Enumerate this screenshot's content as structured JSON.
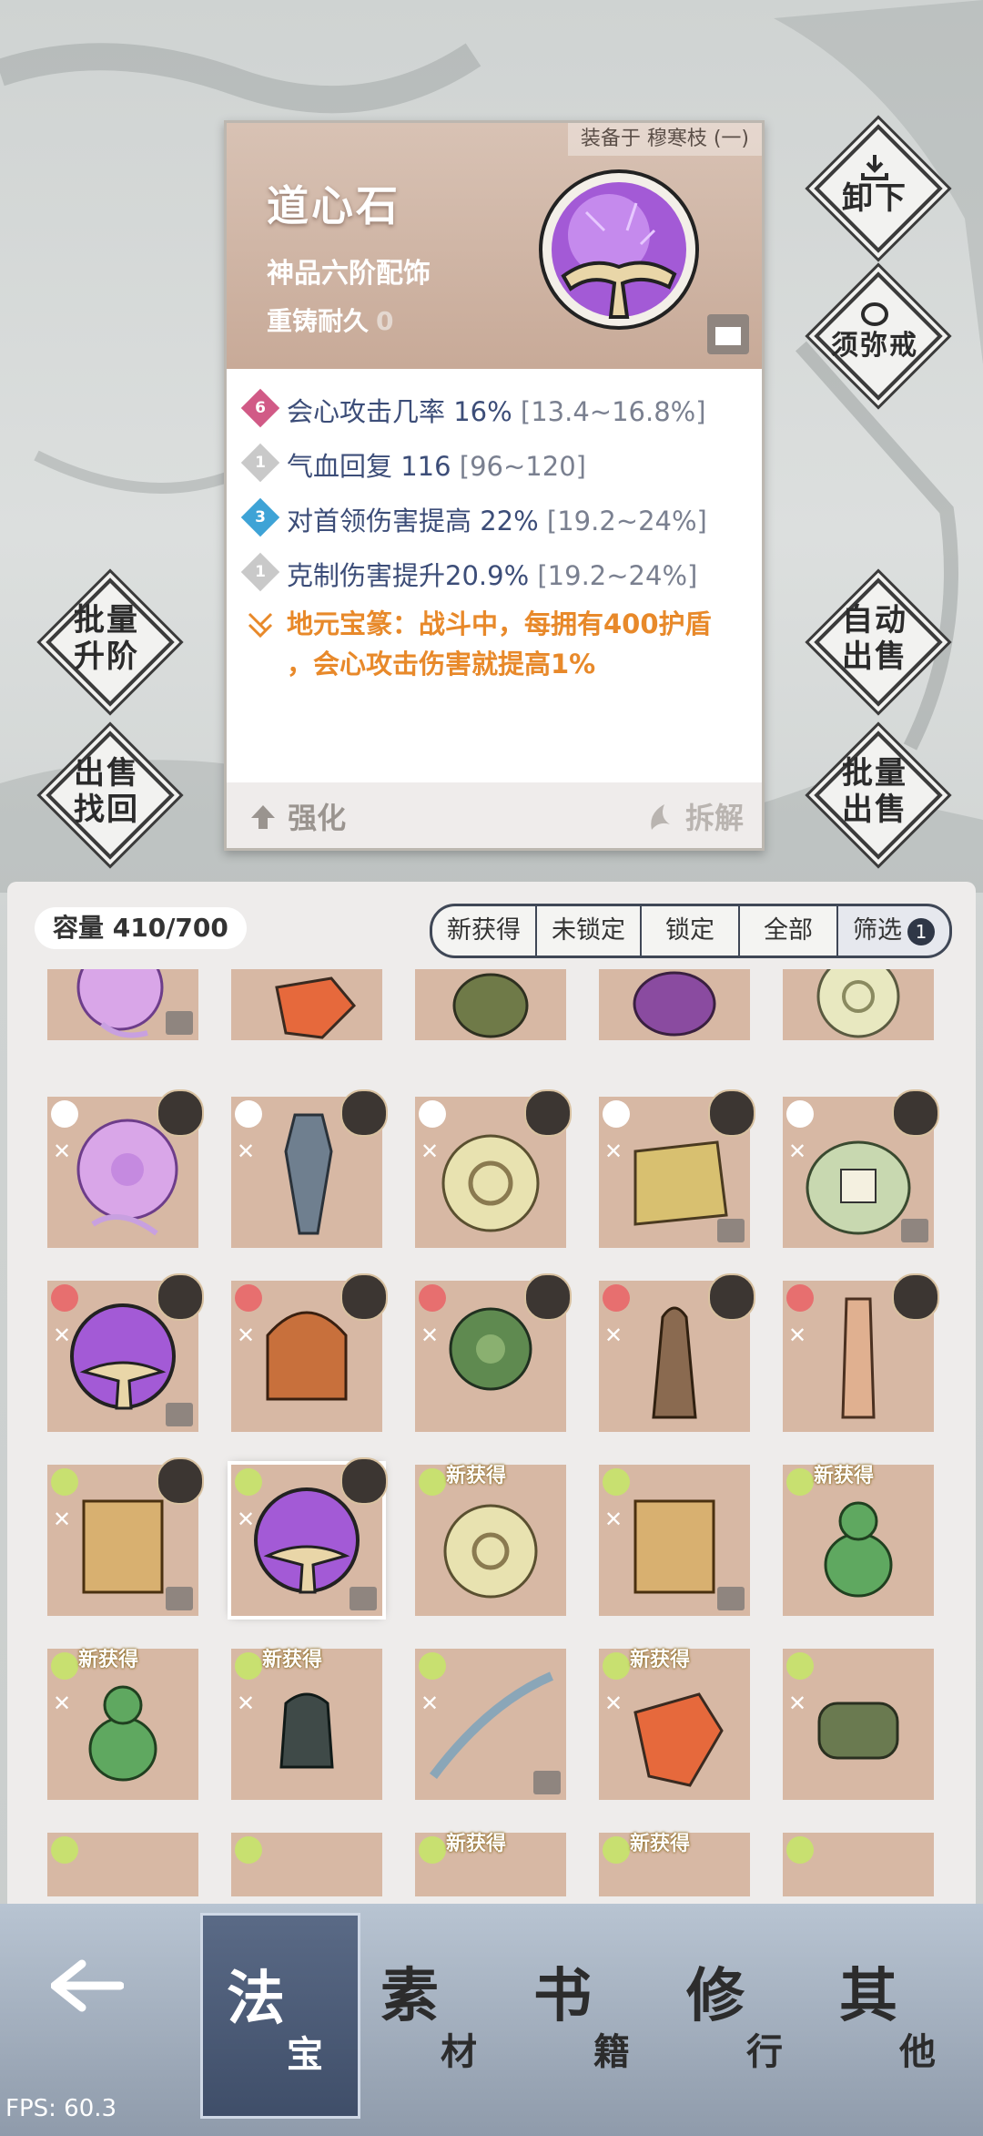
{
  "item": {
    "equipped_on": "装备于 穆寒枝 (一)",
    "name": "道心石",
    "grade": "神品六阶配饰",
    "reforge_label": "重铸耐久",
    "reforge_value": "0",
    "stats": [
      {
        "level": "6",
        "text": "会心攻击几率 16%",
        "range": "[13.4~16.8%]",
        "color": "#d15a86"
      },
      {
        "level": "1",
        "text": "气血回复 116",
        "range": "[96~120]",
        "color": "#c9c9c9"
      },
      {
        "level": "3",
        "text": "对首领伤害提高 22%",
        "range": "[19.2~24%]",
        "color": "#3ea3d6"
      },
      {
        "level": "1",
        "text": "克制伤害提升20.9%",
        "range": "[19.2~24%]",
        "color": "#c9c9c9"
      }
    ],
    "special_line1": "地元宝篆：战斗中，每拥有400护盾",
    "special_line2": "，会心攻击伤害就提高1%",
    "enhance": "强化",
    "dismantle": "拆解"
  },
  "side_buttons": {
    "unequip": "卸下",
    "ring": "须弥戒",
    "batch_upgrade_1": "批量",
    "batch_upgrade_2": "升阶",
    "auto_sell_1": "自动",
    "auto_sell_2": "出售",
    "sell_recover_1": "出售",
    "sell_recover_2": "找回",
    "batch_sell_1": "批量",
    "batch_sell_2": "出售"
  },
  "inventory": {
    "capacity": "容量 410/700",
    "filters": [
      "新获得",
      "未锁定",
      "锁定",
      "全部",
      "筛选"
    ],
    "filter_count": "1",
    "new_label": "新获得"
  },
  "nav": {
    "tabs": [
      {
        "big": "法",
        "small": "宝"
      },
      {
        "big": "素",
        "small": "材"
      },
      {
        "big": "书",
        "small": "籍"
      },
      {
        "big": "修",
        "small": "行"
      },
      {
        "big": "其",
        "small": "他"
      }
    ]
  },
  "fps": "FPS: 60.3"
}
